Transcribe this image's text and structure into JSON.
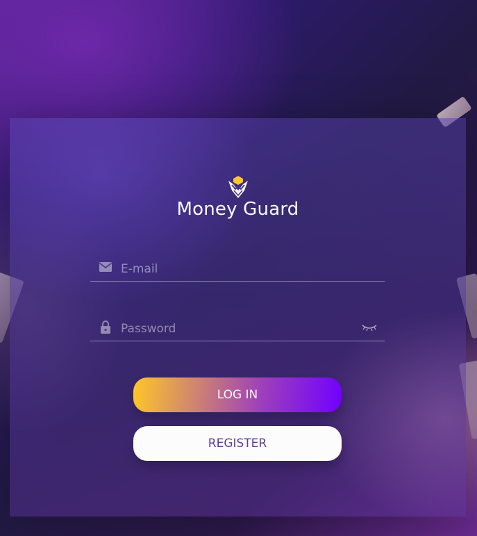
{
  "brand": {
    "name": "Money Guard",
    "logo_icon": "money-guard-shield-icon",
    "logo_accent_color": "#FFC727"
  },
  "form": {
    "email": {
      "placeholder": "E-mail",
      "value": "",
      "icon": "email-envelope-icon"
    },
    "password": {
      "placeholder": "Password",
      "value": "",
      "icon": "lock-icon",
      "toggle_icon": "eye-closed-icon"
    }
  },
  "buttons": {
    "login_label": "LOG IN",
    "register_label": "REGISTER"
  },
  "colors": {
    "login_gradient_start": "#FFC727",
    "login_gradient_mid": "#9E40BA",
    "login_gradient_end": "#7000FF",
    "register_text": "#623F8B",
    "register_background": "#FCFCFC"
  }
}
